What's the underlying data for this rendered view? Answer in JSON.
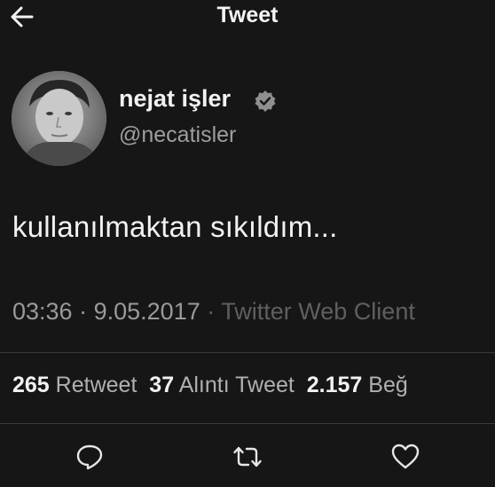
{
  "header": {
    "back_icon": "arrow-left-icon",
    "title": "Tweet"
  },
  "author": {
    "avatar_icon": "profile-photo",
    "display_name": "nejat işler",
    "verified_icon": "verified-badge-icon",
    "handle": "@necatisler"
  },
  "tweet": {
    "text": "kullanılmaktan sıkıldım...",
    "time": "03:36",
    "date": "9.05.2017",
    "separator": "·",
    "client": "Twitter Web Client"
  },
  "stats": {
    "retweets_count": "265",
    "retweets_label": "Retweet",
    "quotes_count": "37",
    "quotes_label": "Alıntı Tweet",
    "likes_count": "2.157",
    "likes_label": "Beğ"
  },
  "actions": {
    "reply_icon": "reply-icon",
    "retweet_icon": "retweet-icon",
    "like_icon": "heart-icon"
  },
  "colors": {
    "background": "#161616",
    "text": "#f2f2f2",
    "muted": "#9e9e9e"
  }
}
